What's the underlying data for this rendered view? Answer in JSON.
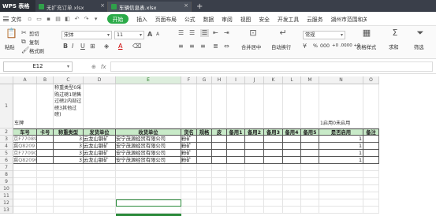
{
  "tabbar": {
    "app_name": "WPS 表格",
    "tabs": [
      {
        "label": "无扩充订单.xlsx",
        "active": false
      },
      {
        "label": "车辆信息表.xlsx",
        "active": true
      }
    ],
    "add_tab": "+"
  },
  "menubar": {
    "file_label": "文件",
    "start_label": "开始",
    "items": [
      "插入",
      "页面布局",
      "公式",
      "数据",
      "审阅",
      "视图",
      "安全",
      "开发工具",
      "云服务",
      "湖州市范围和关系..."
    ]
  },
  "ribbon": {
    "paste": "粘贴",
    "cut": "剪切",
    "copy": "复制",
    "format_painter": "格式刷",
    "font_name": "宋体",
    "font_size": "11",
    "merge_center": "合并居中",
    "wrap_text": "自动换行",
    "number_format": "常规",
    "percent": "%",
    "thousands": "000",
    "decimals_add": "+0 .00",
    "decimals_remove": ".00 +0",
    "table_style": "表格样式",
    "sum": "求和",
    "filter": "筛选",
    "accent_color": "#2bab49"
  },
  "formulabar": {
    "cell_ref": "E12",
    "fx": "fx",
    "content": ""
  },
  "sheet": {
    "columns": [
      "A",
      "B",
      "C",
      "D",
      "E",
      "F",
      "G",
      "H",
      "I",
      "J",
      "K",
      "L",
      "M",
      "N",
      "O"
    ],
    "selected_column": "E",
    "rows": [
      "1",
      "2",
      "3",
      "4",
      "5",
      "6",
      "7",
      "8",
      "9",
      "10",
      "11",
      "12",
      "13"
    ],
    "note_a": "车牌",
    "note_c": "称重类型0采购过磅1销售过磅2内部过磅3其他过磅)",
    "note_n": "1启用0未启用",
    "headers": [
      "车号",
      "卡号",
      "称重类型",
      "发货单位",
      "收货单位",
      "货名",
      "规格",
      "皮",
      "备用1",
      "备用2",
      "备用3",
      "备用4",
      "备用5",
      "是否启用",
      "备注"
    ],
    "data": [
      [
        "京F77089",
        "",
        "3",
        "云龙山钢矿",
        "安宁茂源经贸有限公司",
        "粉矿",
        "",
        "",
        "",
        "",
        "",
        "",
        "",
        "1",
        ""
      ],
      [
        "冀Q82097",
        "",
        "3",
        "云龙山钢矿",
        "安宁茂源经贸有限公司",
        "粉矿",
        "",
        "",
        "",
        "",
        "",
        "",
        "",
        "1",
        ""
      ],
      [
        "京F77090",
        "",
        "3",
        "云龙山钢矿",
        "安宁茂源经贸有限公司",
        "粉矿",
        "",
        "",
        "",
        "",
        "",
        "",
        "",
        "1",
        ""
      ],
      [
        "冀Q82096",
        "",
        "3",
        "云龙山钢矿",
        "安宁茂源经贸有限公司",
        "粉矿",
        "",
        "",
        "",
        "",
        "",
        "",
        "",
        "1",
        ""
      ]
    ]
  }
}
